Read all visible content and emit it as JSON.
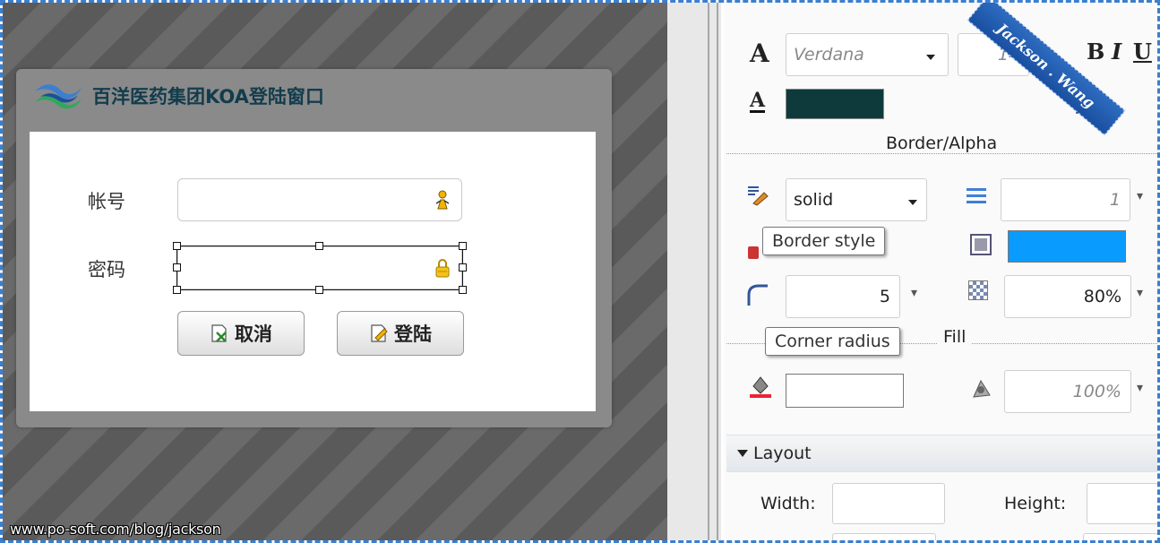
{
  "login": {
    "title": "百洋医药集团KOA登陆窗口",
    "account_label": "帐号",
    "password_label": "密码",
    "cancel_label": "取消",
    "login_label": "登陆"
  },
  "watermark": "www.po-soft.com/blog/jackson",
  "ribbon": "Jackson . Wang",
  "props": {
    "font_family": "Verdana",
    "font_size": "14",
    "border_alpha_title": "Border/Alpha",
    "border_style": "solid",
    "border_width": "1",
    "border_color": "#0a9bff",
    "text_color": "#0f3a3c",
    "corner_radius": "5",
    "opacity": "80%",
    "fill_title": "Fill",
    "fill_opacity": "100%",
    "tooltip_border_style": "Border style",
    "tooltip_corner_radius": "Corner radius",
    "layout_title": "Layout",
    "width_label": "Width:",
    "height_label": "Height:"
  }
}
